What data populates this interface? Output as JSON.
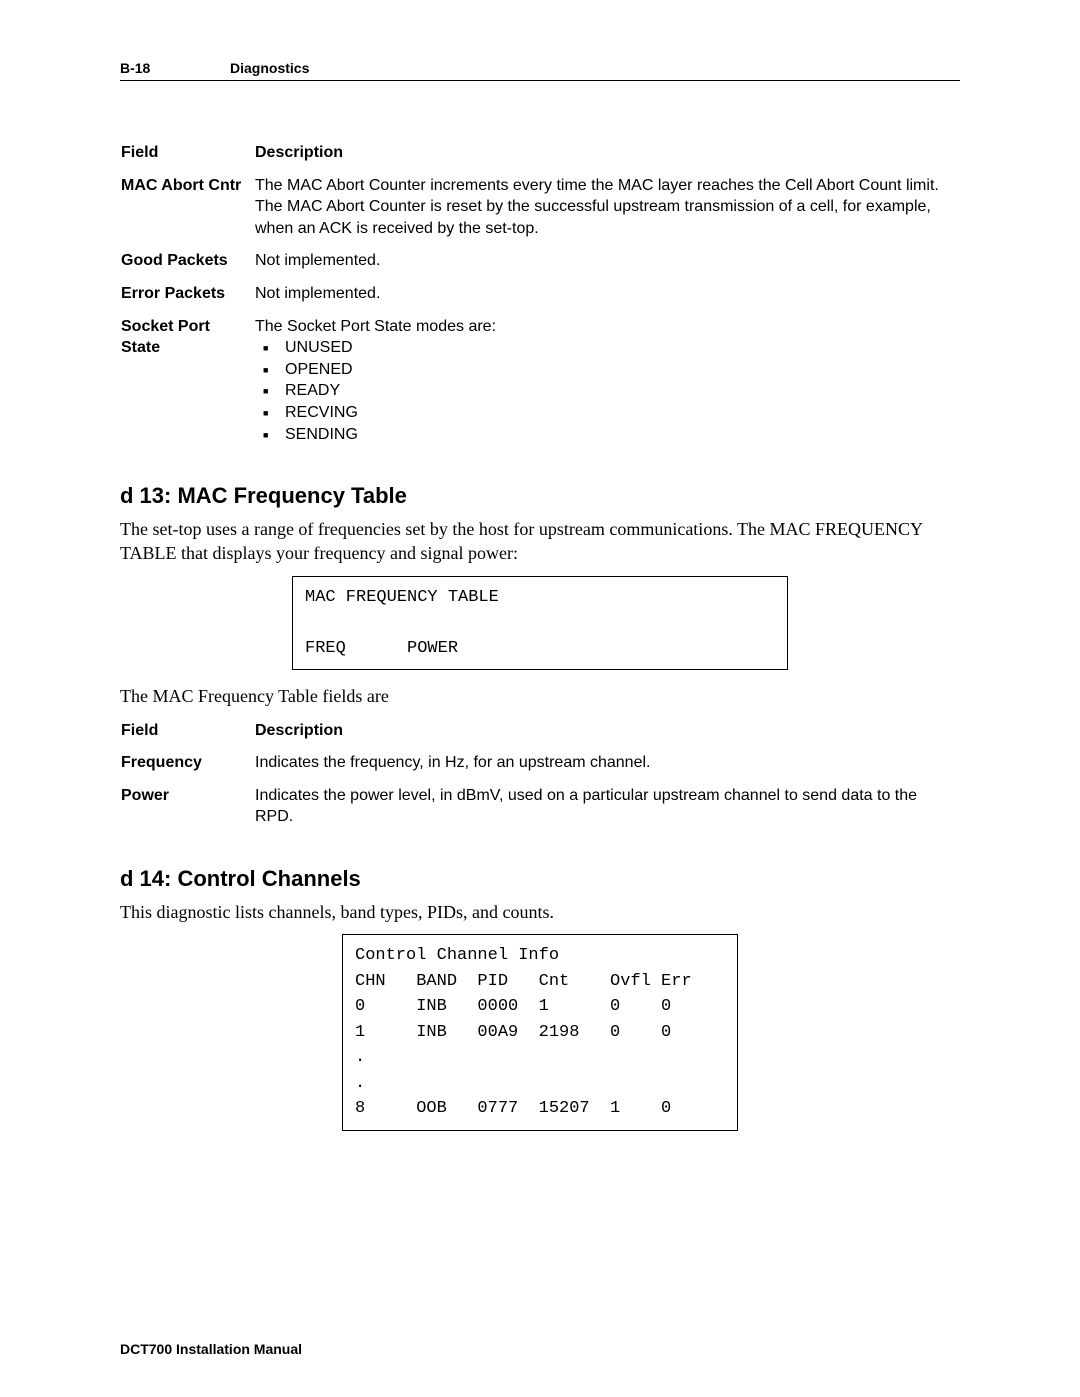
{
  "header": {
    "page_num": "B-18",
    "section": "Diagnostics"
  },
  "table1": {
    "col_field": "Field",
    "col_desc": "Description",
    "rows": [
      {
        "field": "MAC Abort Cntr",
        "desc": "The MAC Abort Counter increments every time the MAC layer reaches the Cell Abort Count limit. The MAC Abort Counter is reset by the successful upstream transmission of a cell, for example, when an ACK is received by the set-top."
      },
      {
        "field": "Good Packets",
        "desc": "Not implemented."
      },
      {
        "field": "Error Packets",
        "desc": "Not implemented."
      }
    ],
    "socket_row": {
      "field": "Socket Port State",
      "intro": "The Socket Port State modes are:",
      "items": [
        "UNUSED",
        "OPENED",
        "READY",
        "RECVING",
        "SENDING"
      ]
    }
  },
  "sec13": {
    "heading": "d 13: MAC Frequency Table",
    "p1": "The set-top uses a range of frequencies set by the host for upstream communications. The MAC FREQUENCY TABLE that displays your frequency and signal power:",
    "box": "MAC FREQUENCY TABLE\n\nFREQ      POWER",
    "p2": "The MAC Frequency Table fields are",
    "table": {
      "col_field": "Field",
      "col_desc": "Description",
      "rows": [
        {
          "field": "Frequency",
          "desc": "Indicates the frequency, in Hz, for an upstream channel."
        },
        {
          "field": "Power",
          "desc": "Indicates the power level, in dBmV, used on a particular upstream channel to send data to the RPD."
        }
      ]
    }
  },
  "sec14": {
    "heading": "d 14: Control Channels",
    "p1": "This diagnostic lists channels, band types, PIDs, and counts.",
    "box": "Control Channel Info\nCHN   BAND  PID   Cnt    Ovfl Err\n0     INB   0000  1      0    0\n1     INB   00A9  2198   0    0\n.\n.\n8     OOB   0777  15207  1    0"
  },
  "footer": "DCT700 Installation Manual"
}
